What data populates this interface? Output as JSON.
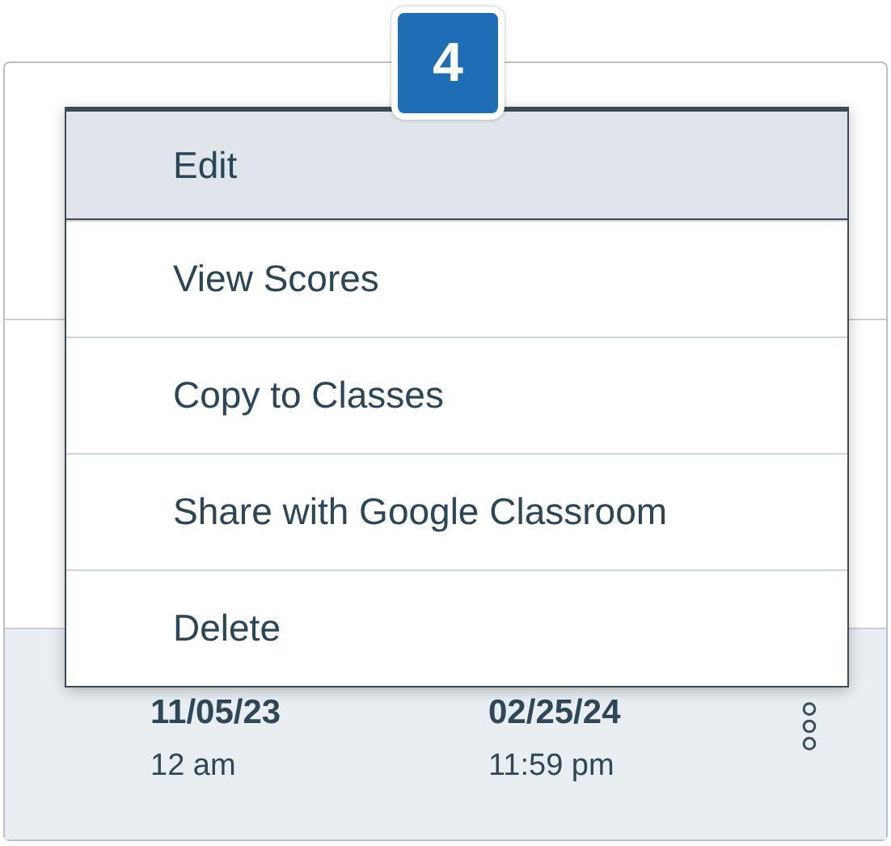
{
  "step_badge": "4",
  "menu": [
    {
      "label": "Edit",
      "selected": true
    },
    {
      "label": "View Scores",
      "selected": false
    },
    {
      "label": "Copy to Classes",
      "selected": false
    },
    {
      "label": "Share with Google Classroom",
      "selected": false
    },
    {
      "label": "Delete",
      "selected": false
    }
  ],
  "row": {
    "start_date": "11/05/23",
    "start_time": "12 am",
    "due_date": "02/25/24",
    "due_time": "11:59 pm"
  }
}
